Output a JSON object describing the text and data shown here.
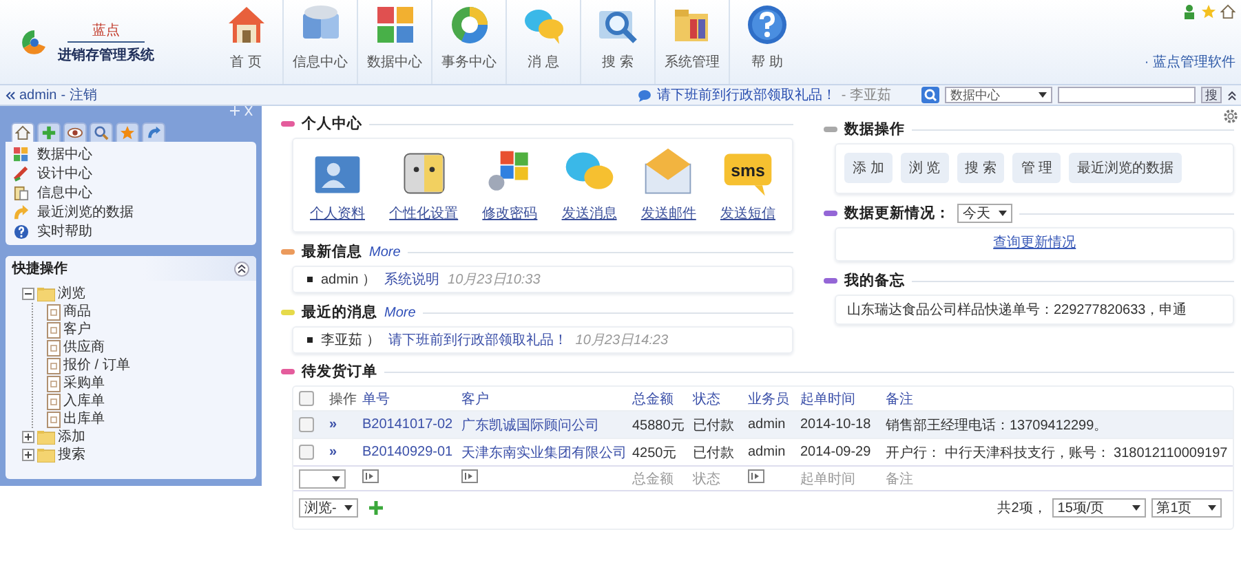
{
  "header": {
    "logo": {
      "brand": "蓝点",
      "product": "进销存管理系统"
    },
    "nav": [
      {
        "label": "首 页"
      },
      {
        "label": "信息中心"
      },
      {
        "label": "数据中心"
      },
      {
        "label": "事务中心"
      },
      {
        "label": "消 息"
      },
      {
        "label": "搜 索"
      },
      {
        "label": "系统管理"
      },
      {
        "label": "帮 助"
      }
    ],
    "link": "· 蓝点管理软件"
  },
  "subbar": {
    "user": "admin",
    "separator": "-",
    "logout": "注销",
    "notice": "请下班前到行政部领取礼品！",
    "notice_author": "- 李亚茹",
    "search": {
      "scope": "数据中心",
      "button": "搜"
    }
  },
  "sidebar": {
    "tabs": [
      {
        "selected": true
      },
      {
        "selected": false
      },
      {
        "selected": false
      },
      {
        "selected": false
      },
      {
        "selected": false
      },
      {
        "selected": false
      }
    ],
    "items": [
      {
        "label": "数据中心"
      },
      {
        "label": "设计中心"
      },
      {
        "label": "信息中心"
      },
      {
        "label": "最近浏览的数据"
      },
      {
        "label": "实时帮助"
      }
    ],
    "quick": {
      "title": "快捷操作",
      "tree": [
        {
          "label": "浏览",
          "expanded": true,
          "children": [
            {
              "label": "商品"
            },
            {
              "label": "客户"
            },
            {
              "label": "供应商"
            },
            {
              "label": "报价 / 订单"
            },
            {
              "label": "采购单"
            },
            {
              "label": "入库单"
            },
            {
              "label": "出库单"
            }
          ]
        },
        {
          "label": "添加",
          "expanded": false
        },
        {
          "label": "搜索",
          "expanded": false
        }
      ]
    }
  },
  "sections": [
    {
      "kind": "personal",
      "title": "个人中心",
      "color": "#e45c9c",
      "items": [
        {
          "label": "个人资料"
        },
        {
          "label": "个性化设置"
        },
        {
          "label": "修改密码"
        },
        {
          "label": "发送消息"
        },
        {
          "label": "发送邮件"
        },
        {
          "label": "发送短信",
          "icon_text": "sms"
        }
      ]
    },
    {
      "kind": "feed",
      "title": "最新信息",
      "more": "More",
      "color": "#eb9a5c",
      "items": [
        {
          "author": "admin ）",
          "title": "系统说明",
          "time": "10月23日10:33"
        }
      ]
    },
    {
      "kind": "feed",
      "title": "最近的消息",
      "more": "More",
      "color": "#e6da4a",
      "items": [
        {
          "author": "李亚茹 ）",
          "title": "请下班前到行政部领取礼品！",
          "time": "10月23日14:23"
        }
      ]
    },
    {
      "kind": "buttons",
      "title": "数据操作",
      "color": "#a9a9a9",
      "buttons": [
        "添 加",
        "浏 览",
        "搜 索",
        "管 理",
        "最近浏览的数据"
      ]
    },
    {
      "kind": "updates",
      "title": "数据更新情况：",
      "color": "#9466d6",
      "period": "今天",
      "link": "查询更新情况"
    },
    {
      "kind": "memo",
      "title": "我的备忘",
      "color": "#9466d6",
      "text": "山东瑞达食品公司样品快递单号：229277820633，申通"
    }
  ],
  "orders": {
    "title": "待发货订单",
    "color": "#e45c9c",
    "all_checked": false,
    "columns": [
      "操作",
      "单号",
      "客户",
      "总金额",
      "状态",
      "业务员",
      "起单时间",
      "备注"
    ],
    "rows": [
      {
        "checked": false,
        "selected": true,
        "action": "»",
        "number": "B20141017-02",
        "customer": "广东凯诚国际顾问公司",
        "amount": "45880元",
        "status": "已付款",
        "staff": "admin",
        "date": "2014-10-18",
        "note": "销售部王经理电话：13709412299。"
      },
      {
        "checked": false,
        "selected": false,
        "action": "»",
        "number": "B20140929-01",
        "customer": "天津东南实业集团有限公司",
        "amount": "4250元",
        "status": "已付款",
        "staff": "admin",
        "date": "2014-09-29",
        "note": "开户行： 中行天津科技支行，账号： 318012110009197"
      }
    ],
    "filters": [
      {
        "kind": "select"
      },
      {
        "kind": "icon"
      },
      {
        "kind": "icon"
      },
      {
        "kind": "text",
        "text": "总金额"
      },
      {
        "kind": "text",
        "text": "状态"
      },
      {
        "kind": "icon"
      },
      {
        "kind": "text",
        "text": "起单时间"
      },
      {
        "kind": "text",
        "text": "备注"
      }
    ],
    "footer": {
      "bulk": "浏览-",
      "total": "共2项，",
      "page_size": "15项/页",
      "page": "第1页"
    }
  }
}
